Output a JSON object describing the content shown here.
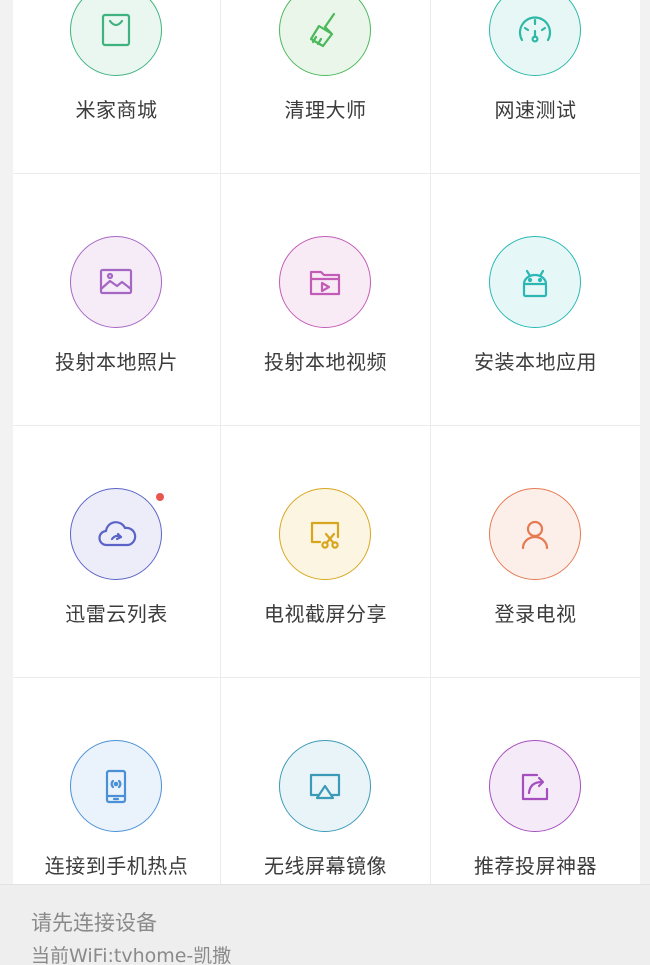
{
  "tools": [
    {
      "label": "米家商城",
      "icon": "shopping-bag-icon",
      "color": "#3fb27f",
      "fill": "#eaf7f0"
    },
    {
      "label": "清理大师",
      "icon": "broom-icon",
      "color": "#4cb85c",
      "fill": "#eaf6e9"
    },
    {
      "label": "网速测试",
      "icon": "speedometer-icon",
      "color": "#2fb8a8",
      "fill": "#e7f7f5"
    },
    {
      "label": "投射本地照片",
      "icon": "photo-icon",
      "color": "#a666c4",
      "fill": "#f5ecf8"
    },
    {
      "label": "投射本地视频",
      "icon": "video-folder-icon",
      "color": "#c25cb6",
      "fill": "#f8ebf5"
    },
    {
      "label": "安装本地应用",
      "icon": "android-icon",
      "color": "#2bb8b5",
      "fill": "#e6f7f7"
    },
    {
      "label": "迅雷云列表",
      "icon": "cloud-icon",
      "color": "#5b63c7",
      "fill": "#ecedf8",
      "badge": true
    },
    {
      "label": "电视截屏分享",
      "icon": "screenshot-scissors-icon",
      "color": "#d8a61e",
      "fill": "#fcf5e2"
    },
    {
      "label": "登录电视",
      "icon": "user-icon",
      "color": "#e67a52",
      "fill": "#fcefe9"
    },
    {
      "label": "连接到手机热点",
      "icon": "phone-hotspot-icon",
      "color": "#4a90d6",
      "fill": "#eaf2fb"
    },
    {
      "label": "无线屏幕镜像",
      "icon": "airplay-icon",
      "color": "#3a9ab8",
      "fill": "#e9f4f8"
    },
    {
      "label": "推荐投屏神器",
      "icon": "share-icon",
      "color": "#a54fbf",
      "fill": "#f5eaf8"
    }
  ],
  "status": {
    "title": "请先连接设备",
    "wifi": "当前WiFi:tvhome-凯撒"
  }
}
